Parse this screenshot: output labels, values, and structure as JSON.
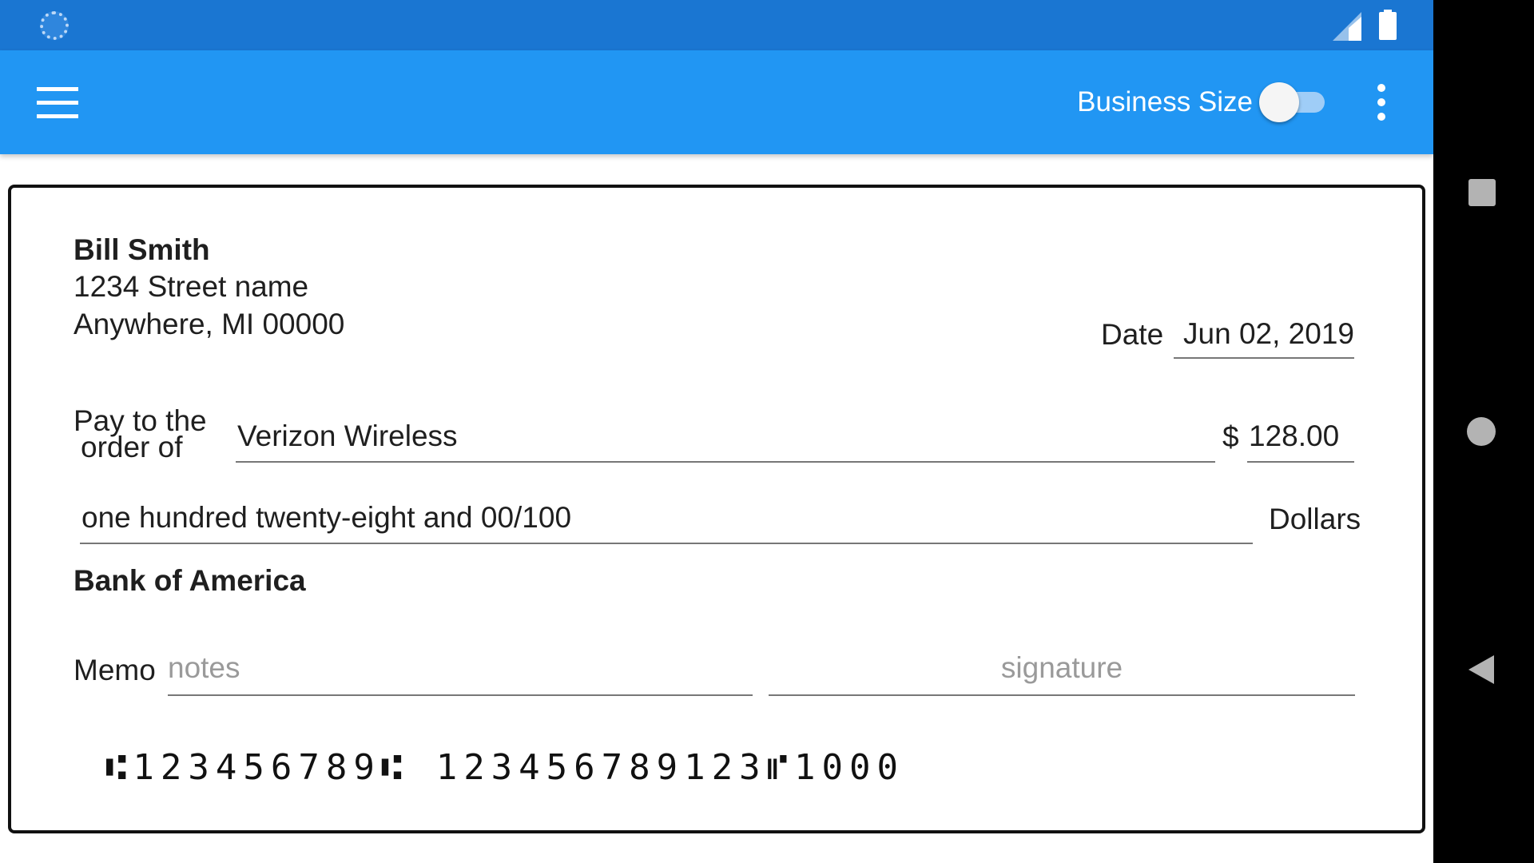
{
  "app_bar": {
    "business_size_label": "Business Size",
    "business_size_on": false,
    "menu_icon": "hamburger-menu-icon",
    "overflow_icon": "more-vert-icon"
  },
  "status_bar": {
    "left_icon": "loading-spinner-icon",
    "signal_icon": "cell-signal-icon",
    "battery_icon": "battery-full-icon"
  },
  "check": {
    "owner_name": "Bill Smith",
    "owner_address_line1": "1234 Street name",
    "owner_address_line2": "Anywhere, MI 00000",
    "date_label": "Date",
    "date_value": "Jun 02, 2019",
    "pay_label_line1": "Pay to the",
    "pay_label_line2": "order of",
    "payee": "Verizon Wireless",
    "currency_symbol": "$",
    "amount": "128.00",
    "amount_words": "one hundred twenty-eight and 00/100",
    "dollars_label": "Dollars",
    "bank_name": "Bank of America",
    "memo_label": "Memo",
    "memo_placeholder": "notes",
    "signature_placeholder": "signature",
    "micr": "⑆123456789⑆ 123456789123⑈1000"
  },
  "nav_bar": {
    "recents_icon": "recents-square-icon",
    "home_icon": "home-circle-icon",
    "back_icon": "back-triangle-icon"
  },
  "colors": {
    "status_bar": "#1a76d2",
    "app_bar": "#2196f3",
    "nav_bar": "#000000"
  }
}
